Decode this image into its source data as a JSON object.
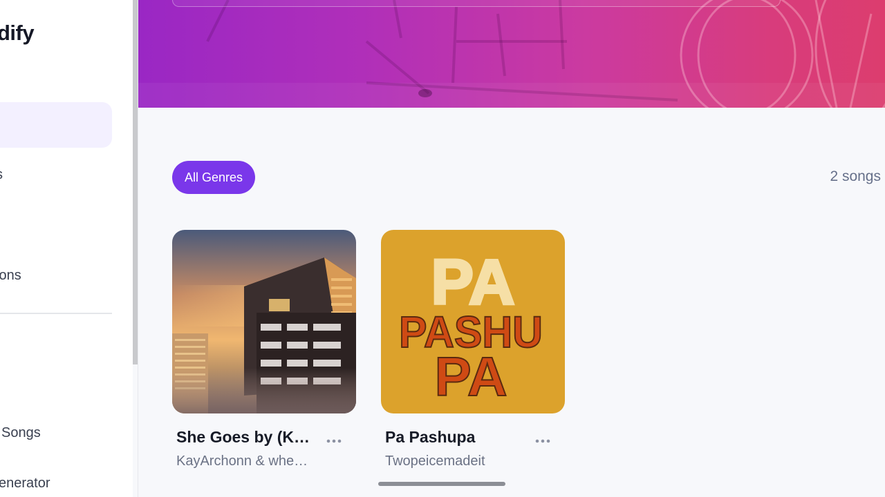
{
  "sidebar": {
    "logo": "dify",
    "items": [
      {
        "label": "s"
      },
      {
        "label": "ions"
      },
      {
        "label": "Songs"
      },
      {
        "label": "enerator"
      }
    ]
  },
  "filters": {
    "genre_chip": "All Genres",
    "song_count": "2 songs"
  },
  "songs": [
    {
      "title": "She Goes by (K…",
      "artist": "KayArchonn & whe…",
      "cover_icon": "city-sunset-cover"
    },
    {
      "title": "Pa Pashupa",
      "artist": "Twopeicemadeit",
      "cover_icon": "pa-pashupa-cover",
      "cover_text": [
        "PA",
        "PASHU",
        "PA"
      ]
    }
  ],
  "colors": {
    "accent": "#7a37ea",
    "hero_start": "#9a27c4",
    "hero_end": "#dc3d6e"
  }
}
